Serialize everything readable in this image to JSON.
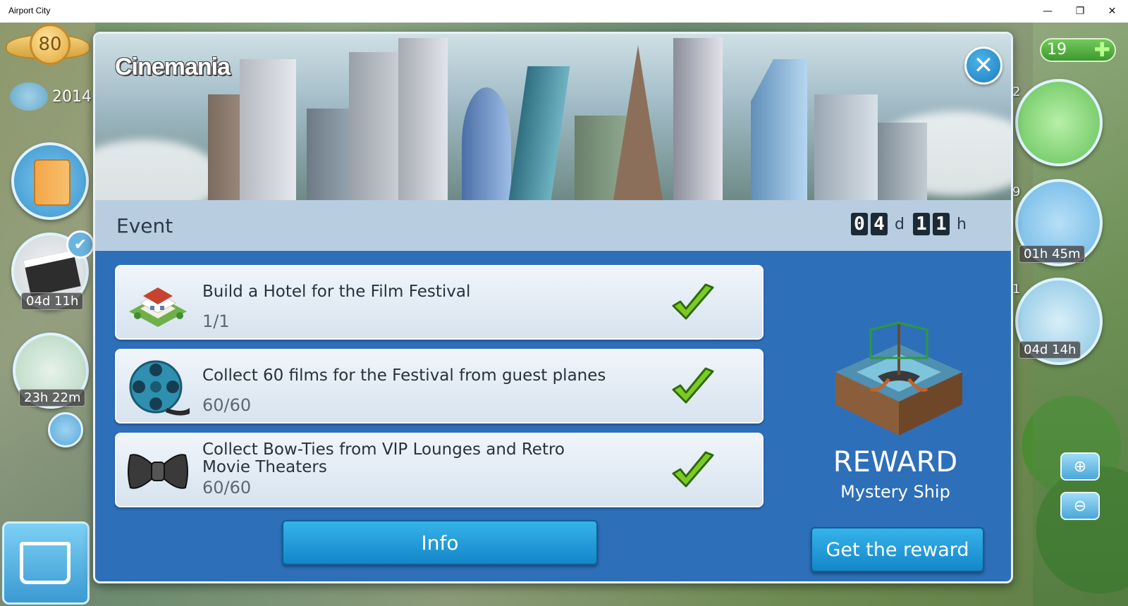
{
  "window": {
    "title": "Airport City",
    "minimize_glyph": "—",
    "maximize_glyph": "❐",
    "close_glyph": "✕"
  },
  "hud": {
    "level": "80",
    "population": "2014",
    "event_timer": "04d 11h",
    "garden_timer": "23h 22m",
    "coins": "19",
    "radar_count": "2",
    "flight_count": "9",
    "flight_timer": "01h 45m",
    "gauge_count": "1",
    "gauge_timer": "04d 14h",
    "zoom_in_glyph": "⊕",
    "zoom_out_glyph": "⊖",
    "coins_plus_glyph": "✚",
    "check_glyph": "✔"
  },
  "dialog": {
    "title": "Cinemania",
    "close_glyph": "✕",
    "event_label": "Event",
    "countdown": {
      "days_digits": [
        "0",
        "4"
      ],
      "days_unit": "d",
      "hours_digits": [
        "1",
        "1"
      ],
      "hours_unit": "h"
    },
    "tasks": [
      {
        "title": "Build a Hotel for the Film Festival",
        "progress": "1/1",
        "icon": "hotel-icon",
        "completed": true
      },
      {
        "title": "Collect 60 films for the Festival from guest planes",
        "progress": "60/60",
        "icon": "film-reel-icon",
        "completed": true
      },
      {
        "title": "Collect Bow-Ties from VIP Lounges and Retro Movie Theaters",
        "progress": "60/60",
        "icon": "bow-tie-icon",
        "completed": true
      }
    ],
    "info_button": "Info",
    "reward": {
      "heading": "REWARD",
      "name": "Mystery Ship",
      "button": "Get the reward"
    }
  },
  "colors": {
    "dialog_blue": "#2e6fba",
    "button_blue": "#1e9ad8",
    "check_green": "#6ec01e",
    "event_bar": "#b8cde0"
  }
}
